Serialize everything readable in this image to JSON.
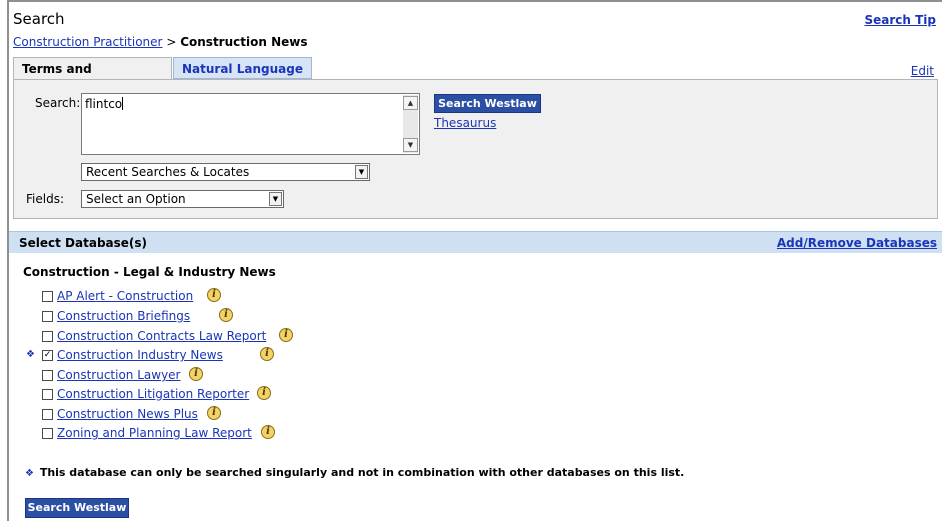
{
  "header": {
    "title": "Search",
    "search_tips": "Search Tip",
    "breadcrumb": {
      "parent": "Construction Practitioner",
      "separator": ">",
      "current": "Construction News"
    }
  },
  "tabs": [
    {
      "label": "Terms and Connectors",
      "active": true
    },
    {
      "label": "Natural Language",
      "active": false
    }
  ],
  "edit_label": "Edit",
  "search": {
    "label": "Search:",
    "value": "flintco",
    "button_label": "Search Westlaw",
    "thesaurus_label": "Thesaurus",
    "recent_select": "Recent Searches & Locates",
    "fields_label": "Fields:",
    "fields_select": "Select an Option"
  },
  "databases": {
    "header_title": "Select Database(s)",
    "add_remove_label": "Add/Remove Databases",
    "group_title": "Construction - Legal & Industry News",
    "items": [
      {
        "label": "AP Alert - Construction",
        "checked": false,
        "single_only": false
      },
      {
        "label": "Construction Briefings",
        "checked": false,
        "single_only": false
      },
      {
        "label": "Construction Contracts Law Report",
        "checked": false,
        "single_only": false
      },
      {
        "label": "Construction Industry News",
        "checked": true,
        "single_only": true
      },
      {
        "label": "Construction Lawyer",
        "checked": false,
        "single_only": false
      },
      {
        "label": "Construction Litigation Reporter",
        "checked": false,
        "single_only": false
      },
      {
        "label": "Construction News Plus",
        "checked": false,
        "single_only": false
      },
      {
        "label": "Zoning and Planning Law Report",
        "checked": false,
        "single_only": false
      }
    ]
  },
  "footnote": {
    "marker": "❖",
    "text": "This database can only be searched singularly and not in combination with other databases on this list."
  },
  "bottom_button_label": "Search Westlaw",
  "icons": {
    "info": "i",
    "check": "✓",
    "scroll_up": "▲",
    "scroll_down": "▼",
    "dropdown": "▼"
  },
  "colors": {
    "link": "#1a35b8",
    "button": "#2b4fa5",
    "panel": "#f0f0f0",
    "db_header": "#cfe0f3",
    "tab_inactive": "#d6e4f5"
  }
}
